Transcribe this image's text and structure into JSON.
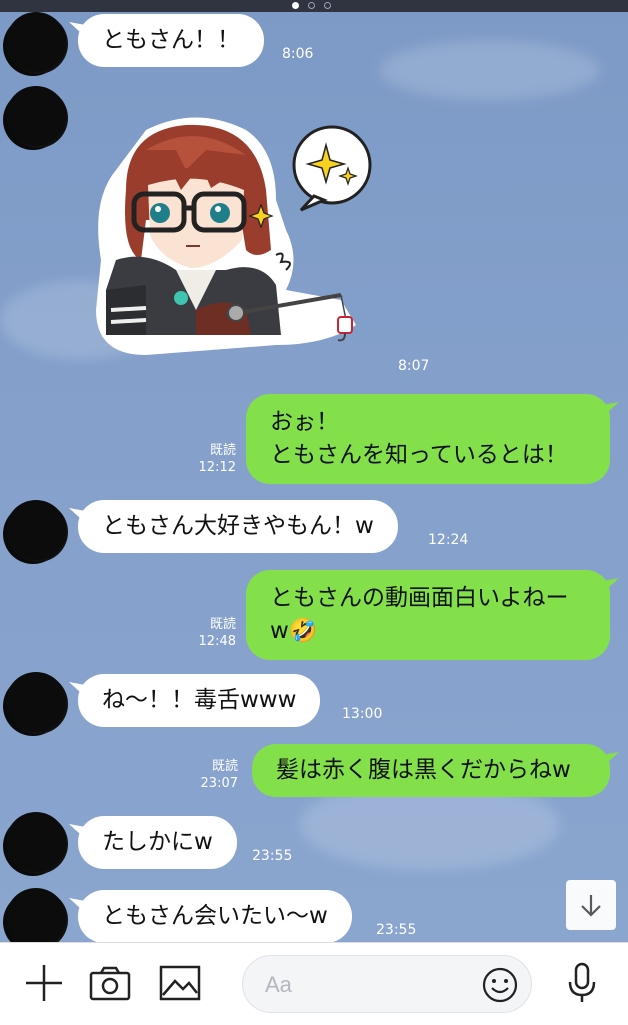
{
  "messages": [
    {
      "side": "in",
      "text": "ともさん！！",
      "time": "8:06"
    },
    {
      "side": "in",
      "type": "sticker",
      "time": "8:07"
    },
    {
      "side": "out",
      "lines": [
        "おぉ！",
        "ともさんを知っているとは！"
      ],
      "read": "既読",
      "time": "12:12"
    },
    {
      "side": "in",
      "text": "ともさん大好きやもん！w",
      "time": "12:24"
    },
    {
      "side": "out",
      "lines": [
        "ともさんの動画面白いよねー",
        "w🤣"
      ],
      "read": "既読",
      "time": "12:48"
    },
    {
      "side": "in",
      "text": "ね〜！！毒舌www",
      "time": "13:00"
    },
    {
      "side": "out",
      "text": "髪は赤く腹は黒くだからねw",
      "read": "既読",
      "time": "23:07"
    },
    {
      "side": "in",
      "text": "たしかにw",
      "time": "23:55"
    },
    {
      "side": "in",
      "text": "ともさん会いたい〜w",
      "time": "23:55"
    }
  ],
  "input": {
    "placeholder": "Aa"
  },
  "icons": {
    "plus": "plus-icon",
    "camera": "camera-icon",
    "image": "image-icon",
    "emoji": "emoji-icon",
    "mic": "microphone-icon",
    "scroll": "arrow-down-icon",
    "sticker": "anime-character-fishing-sticker"
  },
  "colors": {
    "outgoing": "#84e04a",
    "incoming": "#ffffff",
    "background": "#82a0cb"
  }
}
